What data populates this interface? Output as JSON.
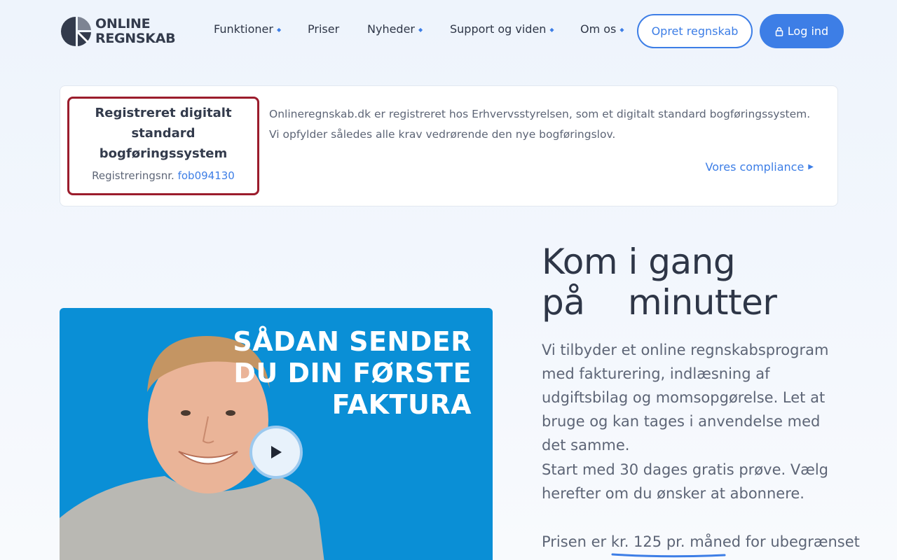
{
  "brand": {
    "line1": "ONLINE",
    "line2": "REGNSKAB"
  },
  "nav": {
    "items": [
      {
        "label": "Funktioner",
        "dropdown": true
      },
      {
        "label": "Priser",
        "dropdown": false
      },
      {
        "label": "Nyheder",
        "dropdown": true
      },
      {
        "label": "Support og viden",
        "dropdown": true
      },
      {
        "label": "Om os",
        "dropdown": true
      }
    ],
    "create_account": "Opret regnskab",
    "login": "Log ind"
  },
  "compliance": {
    "title": "Registreret digitalt standard bogføringssystem",
    "reg_label": "Registreringsnr.",
    "reg_number": "fob094130",
    "line1": "Onlineregnskab.dk er registreret hos Erhvervsstyrelsen, som et digitalt standard bogføringssystem.",
    "line2": "Vi opfylder således alle krav vedrørende den nye bogføringslov.",
    "link": "Vores compliance"
  },
  "video": {
    "title_line1": "SÅDAN SENDER",
    "title_line2": "DU DIN FØRSTE",
    "title_line3": "FAKTURA"
  },
  "hero": {
    "title_line1": "Kom i gang",
    "title_line2": "på    minutter",
    "p1": "Vi tilbyder et online regnskabsprogram med fakturering, indlæsning af udgiftsbilag og momsopgørelse. Let at bruge og kan tages i anvendelse med det samme.",
    "p2": "Start med 30 dages gratis prøve. Vælg herefter om du ønsker at abonnere.",
    "p3_prefix": "Prisen er ",
    "p3_price": "kr. 125 pr. måned",
    "p3_suffix": " for ubegrænset"
  },
  "colors": {
    "accent": "#3d7ee6",
    "registration_border": "#9b1c2c",
    "video_bg": "#0a8fd6"
  },
  "icons": {
    "nav_caret": "caret-down-icon",
    "login": "lock-icon",
    "compliance_link": "triangle-right-icon",
    "video": "play-icon"
  }
}
